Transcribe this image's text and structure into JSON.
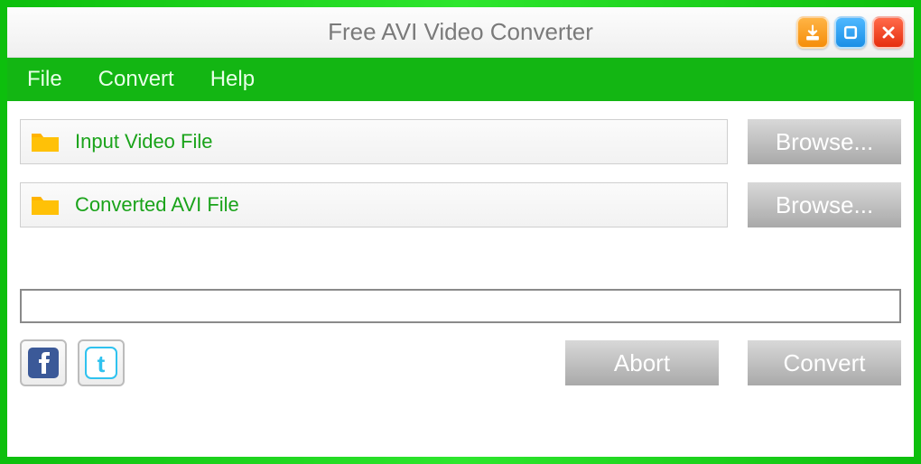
{
  "title": "Free AVI Video Converter",
  "menu": {
    "file": "File",
    "convert": "Convert",
    "help": "Help"
  },
  "fields": {
    "input_label": "Input Video File",
    "output_label": "Converted AVI File",
    "browse_label": "Browse..."
  },
  "actions": {
    "abort": "Abort",
    "convert": "Convert"
  },
  "colors": {
    "accent_green": "#13b613",
    "link_green": "#1aa31a"
  }
}
